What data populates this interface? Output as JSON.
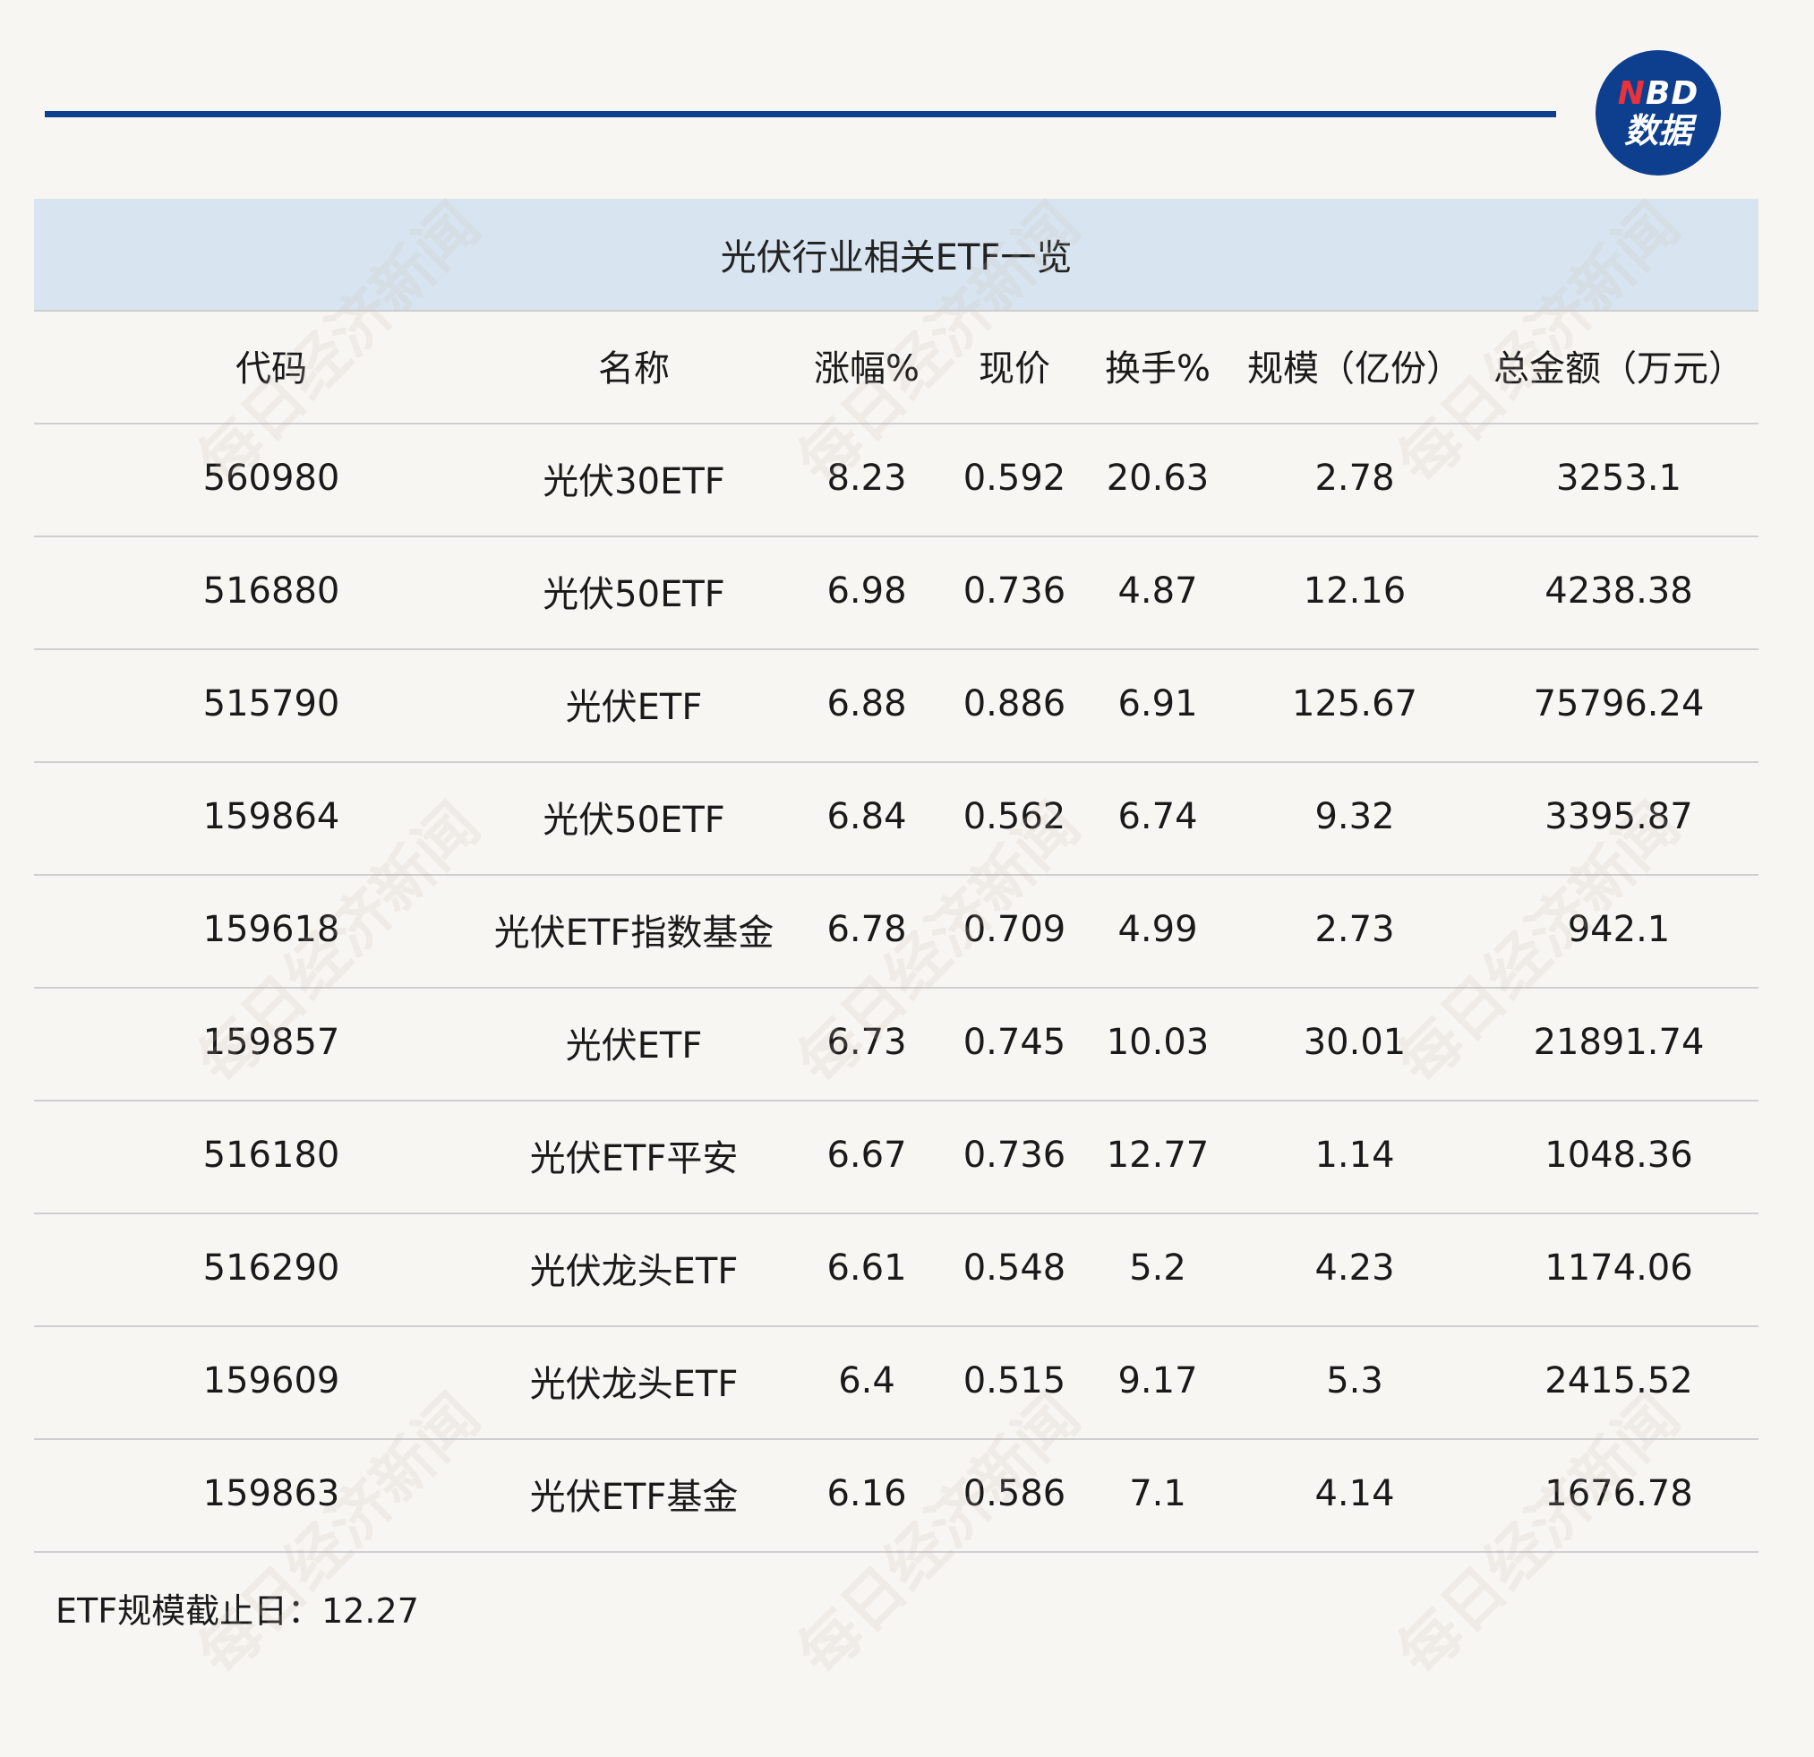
{
  "logo": {
    "line1_n": "N",
    "line1_rest": "BD",
    "line2": "数据"
  },
  "watermark_text": "每日经济新闻",
  "table": {
    "title": "光伏行业相关ETF一览",
    "headers": [
      "代码",
      "名称",
      "涨幅%",
      "现价",
      "换手%",
      "规模（亿份）",
      "总金额（万元）"
    ],
    "rows": [
      [
        "560980",
        "光伏30ETF",
        "8.23",
        "0.592",
        "20.63",
        "2.78",
        "3253.1"
      ],
      [
        "516880",
        "光伏50ETF",
        "6.98",
        "0.736",
        "4.87",
        "12.16",
        "4238.38"
      ],
      [
        "515790",
        "光伏ETF",
        "6.88",
        "0.886",
        "6.91",
        "125.67",
        "75796.24"
      ],
      [
        "159864",
        "光伏50ETF",
        "6.84",
        "0.562",
        "6.74",
        "9.32",
        "3395.87"
      ],
      [
        "159618",
        "光伏ETF指数基金",
        "6.78",
        "0.709",
        "4.99",
        "2.73",
        "942.1"
      ],
      [
        "159857",
        "光伏ETF",
        "6.73",
        "0.745",
        "10.03",
        "30.01",
        "21891.74"
      ],
      [
        "516180",
        "光伏ETF平安",
        "6.67",
        "0.736",
        "12.77",
        "1.14",
        "1048.36"
      ],
      [
        "516290",
        "光伏龙头ETF",
        "6.61",
        "0.548",
        "5.2",
        "4.23",
        "1174.06"
      ],
      [
        "159609",
        "光伏龙头ETF",
        "6.4",
        "0.515",
        "9.17",
        "5.3",
        "2415.52"
      ],
      [
        "159863",
        "光伏ETF基金",
        "6.16",
        "0.586",
        "7.1",
        "4.14",
        "1676.78"
      ]
    ]
  },
  "footnote": "ETF规模截止日：12.27",
  "colors": {
    "accent": "#0e3f8f",
    "header_band": "#d8e4ef",
    "background": "#f8f6f2"
  }
}
